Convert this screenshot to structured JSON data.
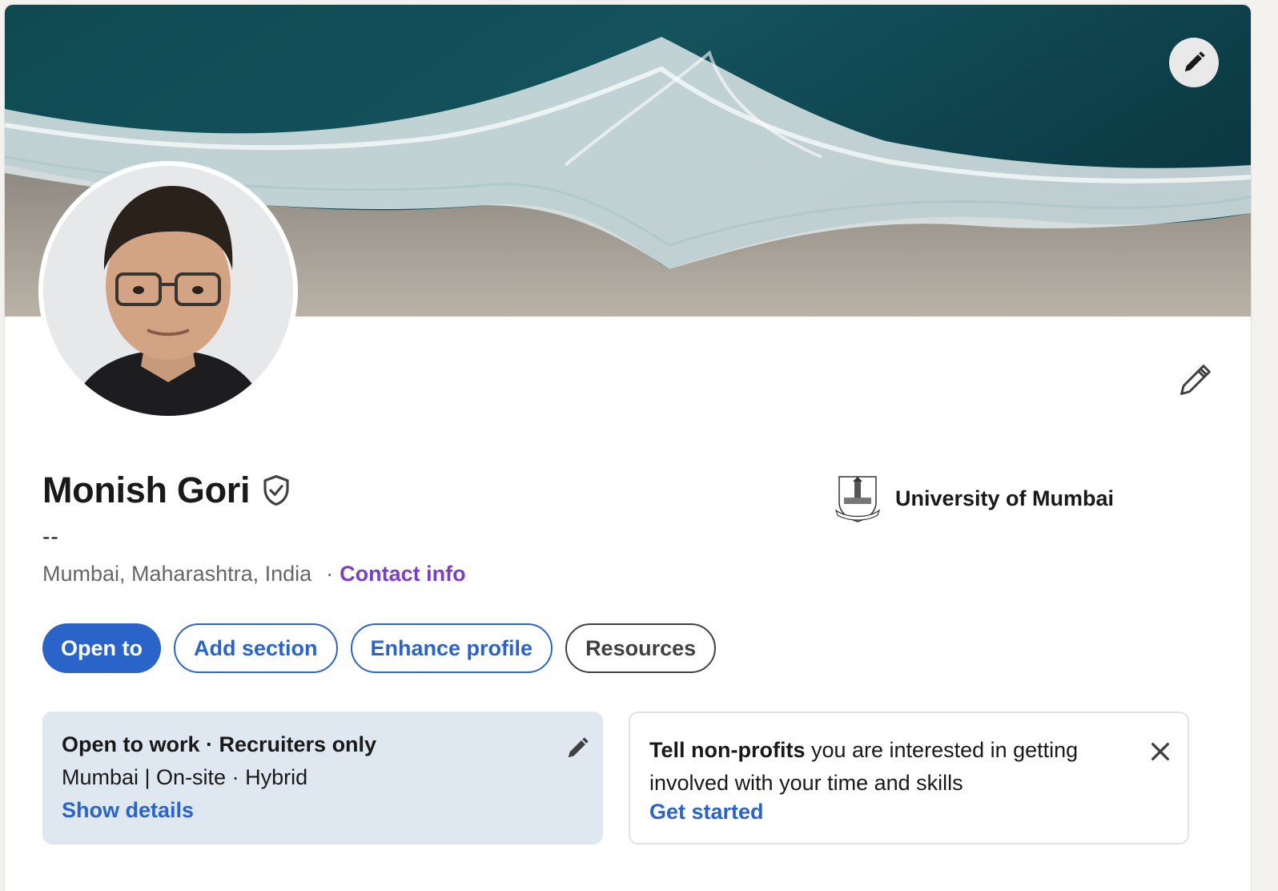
{
  "profile": {
    "name": "Monish Gori",
    "headline": "--",
    "location": "Mumbai, Maharashtra, India",
    "separator": "·",
    "contact_label": "Contact info"
  },
  "education": {
    "name": "University of Mumbai"
  },
  "actions": {
    "open_to": "Open to",
    "add_section": "Add section",
    "enhance_profile": "Enhance profile",
    "resources": "Resources"
  },
  "open_to_work": {
    "title": "Open to work · Recruiters only",
    "details": "Mumbai | On-site · Hybrid",
    "link": "Show details"
  },
  "nonprofit": {
    "bold": "Tell non-profits",
    "text": " you are interested in getting involved with your time and skills",
    "link": "Get started"
  },
  "icons": {
    "cover_edit": "pencil-icon",
    "intro_edit": "pencil-icon",
    "verified": "shield-check-icon",
    "close": "close-icon"
  },
  "colors": {
    "primary": "#2b64c9",
    "contact_link": "#7a3fc7",
    "open_to_work_bg": "#dfe7f0"
  }
}
